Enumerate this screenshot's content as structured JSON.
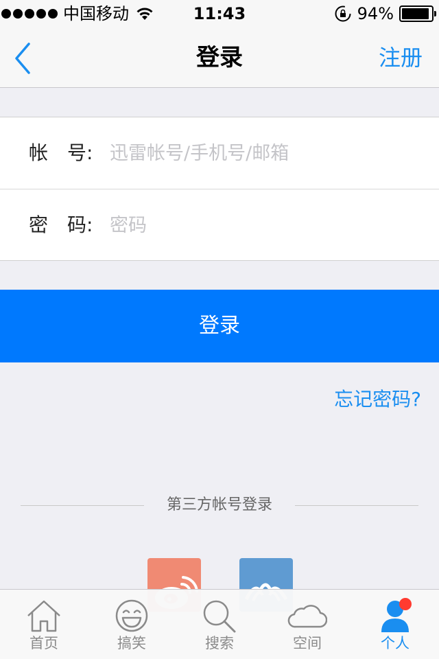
{
  "status_bar": {
    "carrier": "中国移动",
    "time": "11:43",
    "battery_percent": "94%",
    "battery_level": 0.94
  },
  "nav": {
    "title": "登录",
    "back_icon": "chevron-left-icon",
    "register_label": "注册"
  },
  "form": {
    "account_label": "帐　号:",
    "account_placeholder": "迅雷帐号/手机号/邮箱",
    "password_label": "密　码:",
    "password_placeholder": "密码"
  },
  "login_button_label": "登录",
  "forgot_password_label": "忘记密码?",
  "third_party": {
    "heading": "第三方帐号登录",
    "providers": [
      "weibo-icon",
      "xiaomi-icon"
    ]
  },
  "tab_bar": {
    "items": [
      {
        "label": "首页",
        "icon": "home-icon"
      },
      {
        "label": "搞笑",
        "icon": "smiley-icon"
      },
      {
        "label": "搜索",
        "icon": "search-icon"
      },
      {
        "label": "空间",
        "icon": "cloud-icon"
      },
      {
        "label": "个人",
        "icon": "person-icon"
      }
    ],
    "active_index": 4
  },
  "colors": {
    "accent": "#0079fe",
    "link": "#1a8ef0",
    "badge": "#ff3b30",
    "weibo": "#f08a73",
    "xiaomi": "#5f9bd2"
  }
}
